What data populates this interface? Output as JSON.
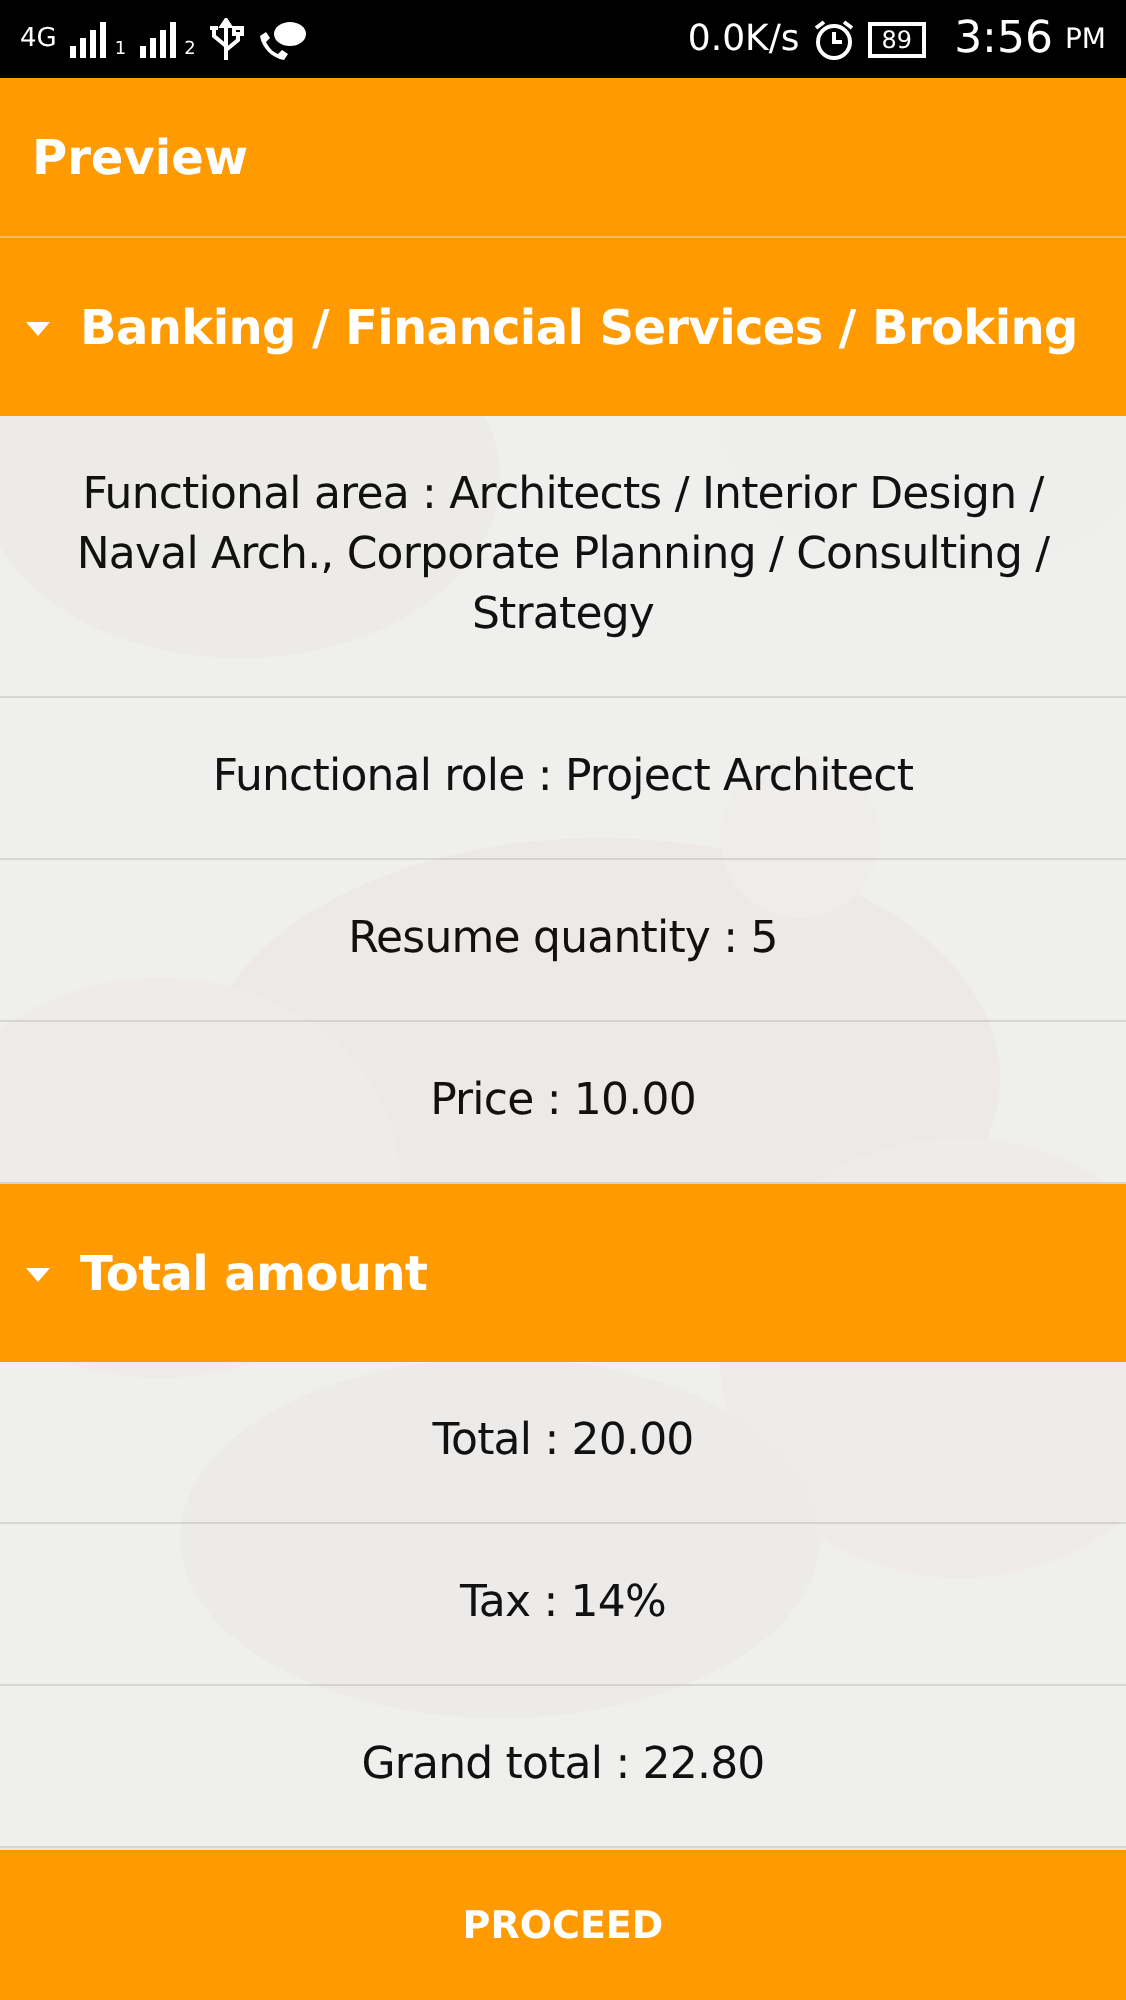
{
  "status_bar": {
    "network": "4G",
    "sim_1": "1",
    "sim_2": "2",
    "speed": "0.0K/s",
    "battery": "89",
    "time": "3:56",
    "meridiem": "PM"
  },
  "app_bar": {
    "title": "Preview"
  },
  "sections": [
    {
      "title": "Banking / Financial Services / Broking",
      "expanded": true,
      "rows": [
        "Functional area : Architects / Interior Design / Naval Arch., Corporate Planning / Consulting / Strategy",
        "Functional role : Project Architect",
        "Resume quantity : 5",
        "Price : 10.00"
      ]
    },
    {
      "title": "Total amount",
      "expanded": true,
      "rows": [
        "Total : 20.00",
        "Tax : 14%",
        "Grand total : 22.80"
      ]
    }
  ],
  "button": {
    "label": "PROCEED"
  }
}
